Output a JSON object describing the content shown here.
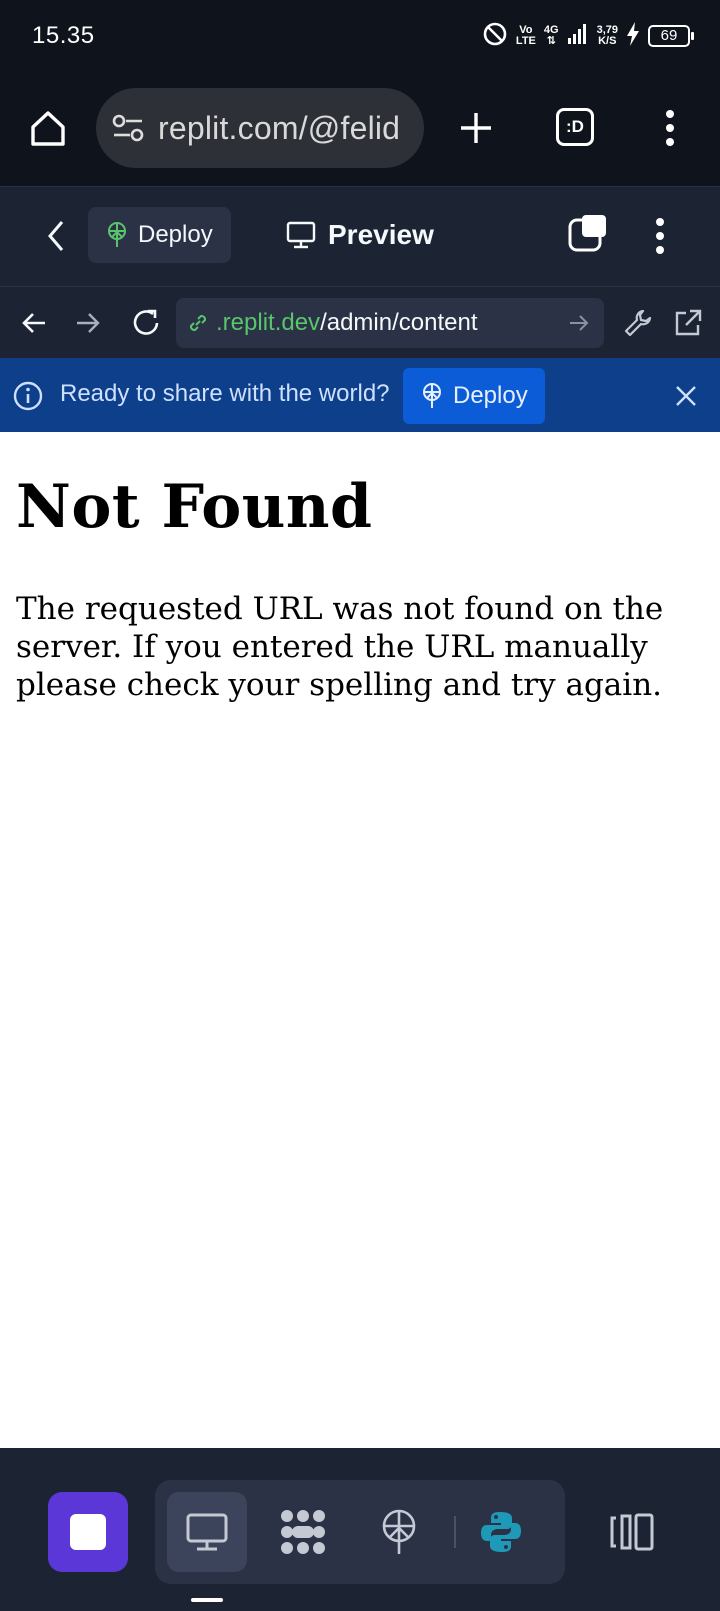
{
  "status_bar": {
    "time": "15.35",
    "volte_top": "Vo",
    "volte_bottom": "LTE",
    "network": "4G",
    "speed_value": "3,79",
    "speed_unit": "K/S",
    "battery": "69"
  },
  "browser": {
    "url": "replit.com/@felid",
    "tab_switcher_label": ":D"
  },
  "replit_header": {
    "deploy_label": "Deploy",
    "preview_label": "Preview"
  },
  "webview": {
    "address_host": ".replit.dev",
    "address_path": "/admin/content"
  },
  "banner": {
    "message": "Ready to share with the world?",
    "button_label": "Deploy"
  },
  "page": {
    "heading": "Not Found",
    "body": "The requested URL was not found on the server. If you entered the URL manually please check your spelling and try again."
  },
  "colors": {
    "dark_bg": "#0f131b",
    "replit_bg": "#1c2333",
    "banner_bg": "#0d3f8a",
    "banner_button": "#0b5cd6",
    "stop_button": "#5a37d6",
    "url_green": "#58c46c",
    "python_blue": "#1e9ab8"
  },
  "dock": {
    "icons": [
      "stop-icon",
      "monitor-icon",
      "workflows-icon",
      "deploy-icon",
      "python-icon",
      "panels-icon"
    ]
  }
}
